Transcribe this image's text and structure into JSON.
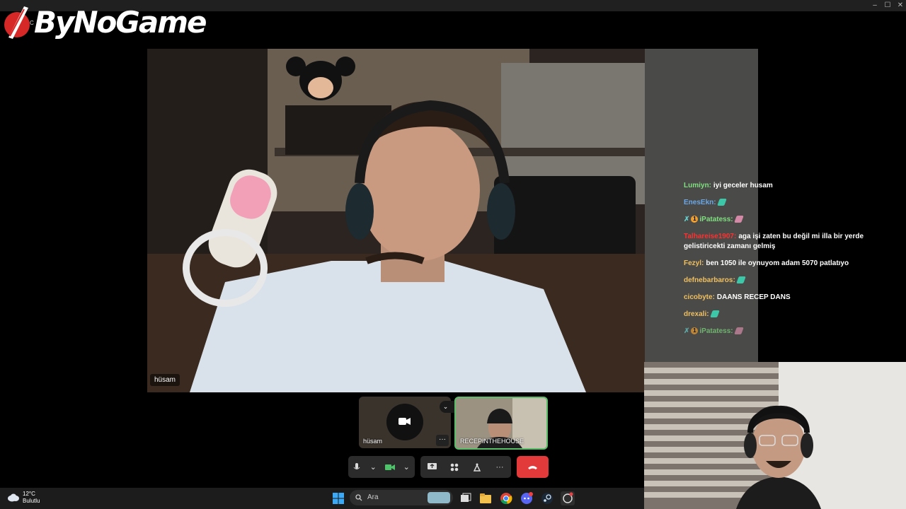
{
  "logo": {
    "text": "ByNoGame",
    "small_text": "C"
  },
  "window_controls": {
    "minimize": "–",
    "maximize": "☐",
    "close": "✕"
  },
  "main_participant": {
    "name": "hüsam"
  },
  "chat": [
    {
      "user": "Lumiyn:",
      "color": "#7fe07f",
      "message": "iyi geceler husam",
      "emote": false,
      "badges": false
    },
    {
      "user": "EnesEkn:",
      "color": "#6aa7e8",
      "message": "",
      "emote": true,
      "badges": false
    },
    {
      "user": "iPatatess:",
      "color": "#7fe07f",
      "message": "",
      "emote": true,
      "badges": true
    },
    {
      "user": "Talhareise1907:",
      "color": "#ff3030",
      "message": "aga işi zaten bu değil mi illa bir yerde gelistiricekti zamanı gelmiş",
      "emote": false,
      "badges": false
    },
    {
      "user": "Fezyl:",
      "color": "#f0c060",
      "message": "ben 1050 ile oynuyom adam 5070 patlatıyo",
      "emote": false,
      "badges": false
    },
    {
      "user": "defnebarbaros:",
      "color": "#f0c060",
      "message": "",
      "emote": true,
      "badges": false
    },
    {
      "user": "cicobyte:",
      "color": "#f0c060",
      "message": "DAANS RECEP DANS",
      "emote": false,
      "badges": false
    },
    {
      "user": "drexali:",
      "color": "#f0c060",
      "message": "",
      "emote": true,
      "badges": false
    },
    {
      "user": "iPatatess:",
      "color": "#7fe07f",
      "message": "",
      "emote": true,
      "badges": true
    }
  ],
  "tiles": [
    {
      "name": "hüsam"
    },
    {
      "name": "RECEPINTHEHOUSE"
    }
  ],
  "tile_more": "···",
  "taskbar": {
    "weather_temp": "12°C",
    "weather_desc": "Bulutlu",
    "search_placeholder": "Ara"
  },
  "colors": {
    "hangup": "#e23a3a",
    "active_border": "#5bbf6a"
  }
}
